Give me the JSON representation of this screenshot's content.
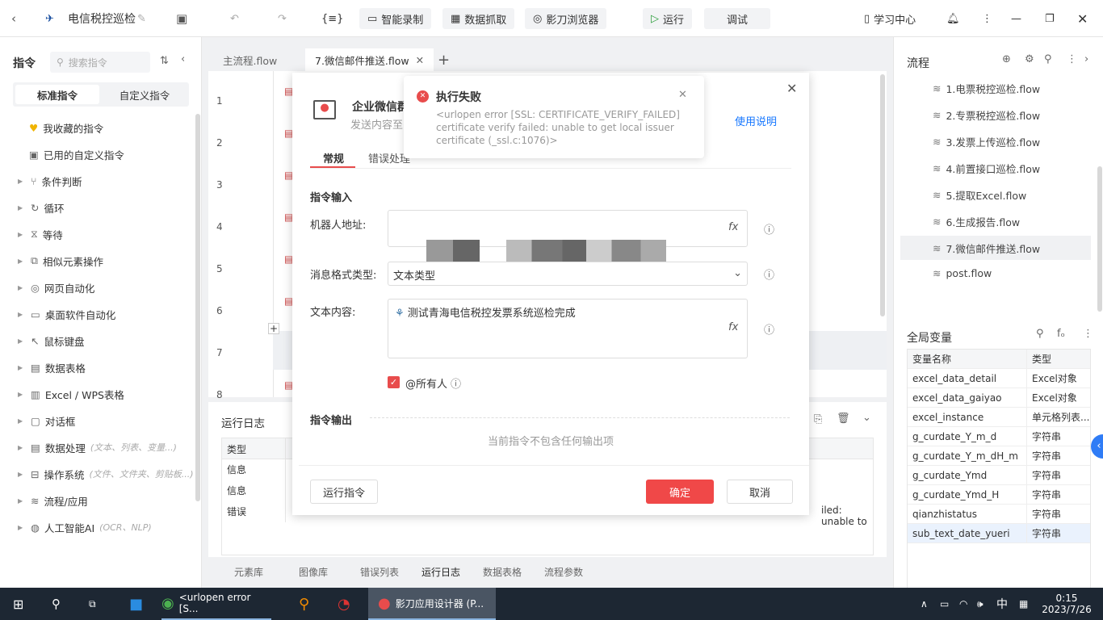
{
  "topbar": {
    "title": "电信税控巡检",
    "code_btn": "{≡}",
    "smart_record": "智能录制",
    "data_grab": "数据抓取",
    "browser": "影刀浏览器",
    "run": "运行",
    "debug": "调试",
    "learn": "学习中心"
  },
  "left": {
    "title": "指令",
    "search_placeholder": "搜索指令",
    "tab_standard": "标准指令",
    "tab_custom": "自定义指令",
    "items": [
      {
        "label": "我收藏的指令",
        "hint": ""
      },
      {
        "label": "已用的自定义指令",
        "hint": ""
      },
      {
        "label": "条件判断",
        "hint": ""
      },
      {
        "label": "循环",
        "hint": ""
      },
      {
        "label": "等待",
        "hint": ""
      },
      {
        "label": "相似元素操作",
        "hint": ""
      },
      {
        "label": "网页自动化",
        "hint": ""
      },
      {
        "label": "桌面软件自动化",
        "hint": ""
      },
      {
        "label": "鼠标键盘",
        "hint": ""
      },
      {
        "label": "数据表格",
        "hint": ""
      },
      {
        "label": "Excel / WPS表格",
        "hint": ""
      },
      {
        "label": "对话框",
        "hint": ""
      },
      {
        "label": "数据处理",
        "hint": "(文本、列表、变量...)"
      },
      {
        "label": "操作系统",
        "hint": "(文件、文件夹、剪贴板...)"
      },
      {
        "label": "流程/应用",
        "hint": ""
      },
      {
        "label": "人工智能AI",
        "hint": "(OCR、NLP)"
      }
    ]
  },
  "tabs": [
    {
      "label": "主流程.flow"
    },
    {
      "label": "7.微信邮件推送.flow"
    }
  ],
  "line_numbers": [
    "1",
    "2",
    "3",
    "4",
    "5",
    "6",
    "7",
    "8"
  ],
  "modal": {
    "title": "企业微信群",
    "subtitle": "发送内容至",
    "help": "使用说明",
    "tab_general": "常规",
    "tab_error": "错误处理",
    "section_input": "指令输入",
    "robot_label": "机器人地址:",
    "format_label": "消息格式类型:",
    "format_value": "文本类型",
    "content_label": "文本内容:",
    "content_value": "测试青海电信税控发票系统巡检完成",
    "at_all": "@所有人",
    "section_output": "指令输出",
    "no_output": "当前指令不包含任何输出项",
    "run_btn": "运行指令",
    "ok_btn": "确定",
    "cancel_btn": "取消",
    "fx": "fx"
  },
  "toast": {
    "title": "执行失败",
    "message": "<urlopen error [SSL: CERTIFICATE_VERIFY_FAILED] certificate verify failed: unable to get local issuer certificate (_ssl.c:1076)>"
  },
  "log": {
    "title": "运行日志",
    "col_type": "类型",
    "rows": [
      "信息",
      "信息",
      "错误"
    ],
    "error_tail": "iled: unable to"
  },
  "bottom_tabs": [
    "元素库",
    "图像库",
    "错误列表",
    "运行日志",
    "数据表格",
    "流程参数"
  ],
  "right": {
    "flow_title": "流程",
    "flows": [
      "1.电票税控巡检.flow",
      "2.专票税控巡检.flow",
      "3.发票上传巡检.flow",
      "4.前置接口巡检.flow",
      "5.提取Excel.flow",
      "6.生成报告.flow",
      "7.微信邮件推送.flow",
      "post.flow"
    ],
    "var_title": "全局变量",
    "var_col_name": "变量名称",
    "var_col_type": "类型",
    "vars": [
      {
        "name": "excel_data_detail",
        "type": "Excel对象"
      },
      {
        "name": "excel_data_gaiyao",
        "type": "Excel对象"
      },
      {
        "name": "excel_instance",
        "type": "单元格列表..."
      },
      {
        "name": "g_curdate_Y_m_d",
        "type": "字符串"
      },
      {
        "name": "g_curdate_Y_m_dH_m",
        "type": "字符串"
      },
      {
        "name": "g_curdate_Ymd",
        "type": "字符串"
      },
      {
        "name": "g_curdate_Ymd_H",
        "type": "字符串"
      },
      {
        "name": "qianzhistatus",
        "type": "字符串"
      },
      {
        "name": "sub_text_date_yueri",
        "type": "字符串"
      }
    ]
  },
  "taskbar": {
    "chrome": "<urlopen error [S...",
    "yingdao": "影刀应用设计器 (P...",
    "time": "0:15",
    "date": "2023/7/26",
    "ime": "中"
  },
  "colors": {
    "accent": "#e84c4c",
    "link": "#1677ff"
  }
}
